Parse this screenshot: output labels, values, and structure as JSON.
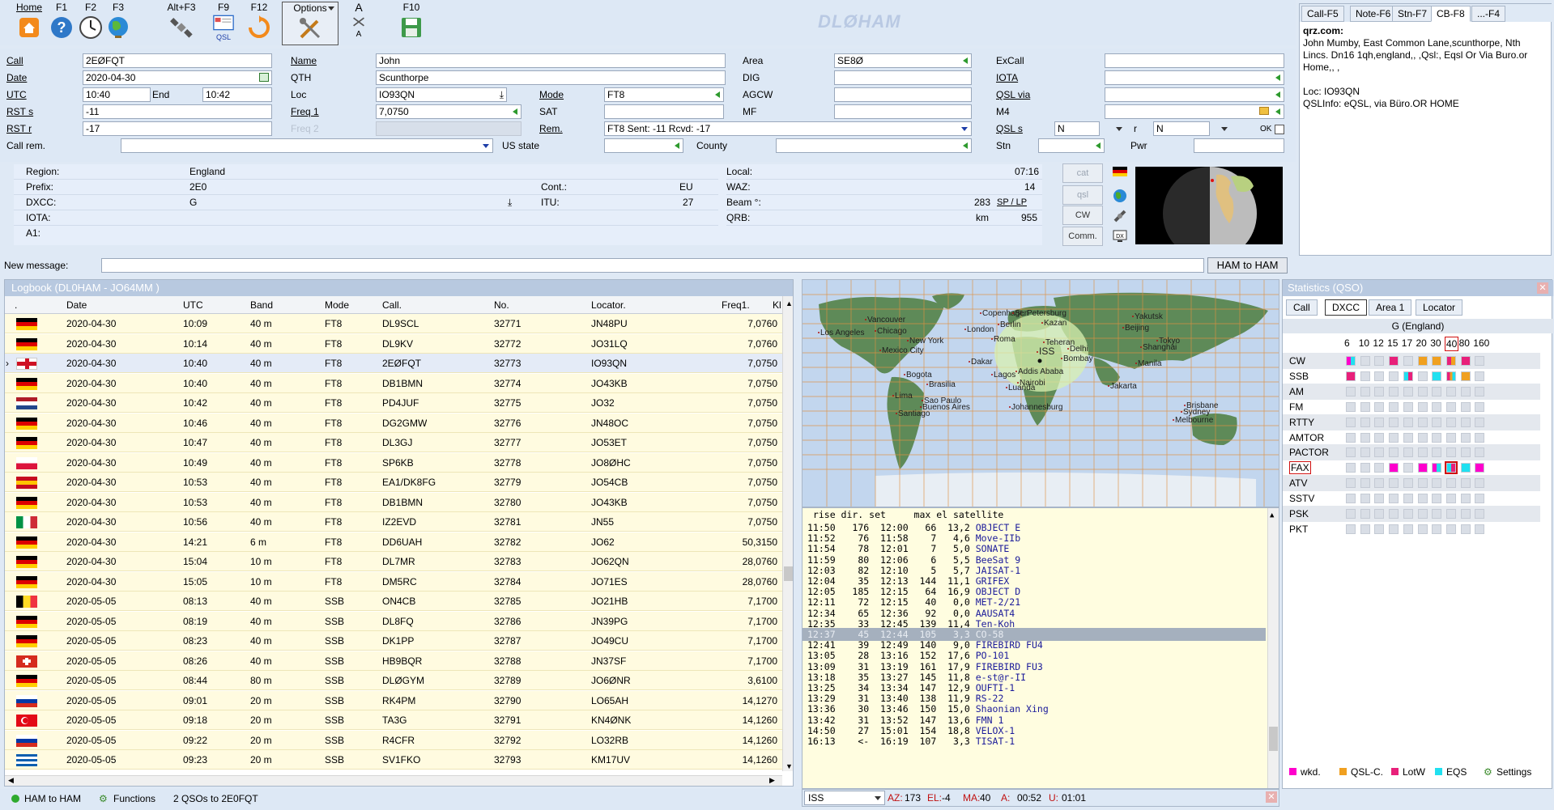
{
  "toolbar": {
    "buttons": [
      {
        "label": "Home",
        "icon": "home-icon"
      },
      {
        "label": "F1",
        "icon": "help-icon"
      },
      {
        "label": "F2",
        "icon": "clock-icon"
      },
      {
        "label": "F3",
        "icon": "globe-icon"
      },
      {
        "label": "Alt+F3",
        "icon": "satellite-icon"
      },
      {
        "label": "F9",
        "icon": "qsl-card-icon",
        "sub": "QSL"
      },
      {
        "label": "F12",
        "icon": "refresh-icon"
      },
      {
        "label": "Options",
        "icon": "tools-icon"
      },
      {
        "label": "A",
        "icon": "font-size-icon",
        "sub": "A"
      },
      {
        "label": "F10",
        "icon": "save-icon"
      }
    ],
    "brand": "DLØHAM"
  },
  "entry": {
    "call_label": "Call",
    "call": "2EØFQT",
    "date_label": "Date",
    "date": "2020-04-30",
    "utc_label": "UTC",
    "utc": "10:40",
    "end_label": "End",
    "end": "10:42",
    "rsts_label": "RST s",
    "rsts": "-11",
    "rstr_label": "RST r",
    "rstr": "-17",
    "callrem_label": "Call rem.",
    "callrem": "",
    "name_label": "Name",
    "name": "John",
    "qth_label": "QTH",
    "qth": "Scunthorpe",
    "loc_label": "Loc",
    "loc": "IO93QN",
    "freq1_label": "Freq 1",
    "freq1": "7,0750",
    "freq2_label": "Freq 2",
    "freq2": "",
    "mode_label": "Mode",
    "mode": "FT8",
    "sat_label": "SAT",
    "sat": "",
    "rem_label": "Rem.",
    "rem": "FT8  Sent: -11  Rcvd: -17",
    "usstate_label": "US state",
    "usstate": "",
    "area_label": "Area",
    "area": "SE8Ø",
    "dig_label": "DIG",
    "dig": "",
    "agcw_label": "AGCW",
    "agcw": "",
    "mf_label": "MF",
    "mf": "",
    "county_label": "County",
    "county": "",
    "excall_label": "ExCall",
    "excall": "",
    "iota_label": "IOTA",
    "iota": "",
    "qslvia_label": "QSL via",
    "qslvia": "",
    "m4_label": "M4",
    "m4": "",
    "qsls_label": "QSL s",
    "qsls": "N",
    "qslr_label": "r",
    "qslr": "N",
    "ok_label": "OK",
    "stn_label": "Stn",
    "stn": "",
    "pwr_label": "Pwr",
    "pwr": ""
  },
  "info": {
    "region_label": "Region:",
    "region": "England",
    "prefix_label": "Prefix:",
    "prefix": "2E0",
    "dxcc_label": "DXCC:",
    "dxcc": "G",
    "iota_label": "IOTA:",
    "iota": "",
    "a1_label": "A1:",
    "a1": "",
    "cont_label": "Cont.:",
    "cont": "EU",
    "itu_label": "ITU:",
    "itu": "27",
    "local_label": "Local:",
    "local": "07:16",
    "waz_label": "WAZ:",
    "waz": "14",
    "beam_label": "Beam °:",
    "beam": "283",
    "splp": "SP / LP",
    "qrb_label": "QRB:",
    "qrb_unit": "km",
    "qrb": "955"
  },
  "side_buttons": [
    "cat",
    "qsl",
    "CW",
    "Comm."
  ],
  "qrz_tabs": [
    "Call-F5",
    "Note-F6",
    "Stn-F7",
    "CB-F8",
    "...-F4"
  ],
  "qrz": {
    "source": "qrz.com:",
    "address": "John Mumby, East Common Lane,scunthorpe, Nth Lincs. Dn16 1qh,england,, ,Qsl:, Eqsl Or Via Buro.or Home,, ,",
    "loc": "Loc:  IO93QN",
    "qslinfo": "QSLInfo:  eQSL, via Büro.OR HOME"
  },
  "message": {
    "label": "New message:",
    "value": "",
    "button": "HAM to HAM"
  },
  "logbook": {
    "title": "Logbook  (DL0HAM - JO64MM )",
    "headers": [
      ".",
      "Date",
      "UTC",
      "Band",
      "Mode",
      "Call.",
      "No.",
      "Locator.",
      "Freq1.",
      "Kl"
    ],
    "rows": [
      {
        "flag": "de",
        "date": "2020-04-30",
        "utc": "10:09",
        "band": "40 m",
        "mode": "FT8",
        "call": "DL9SCL",
        "no": "32771",
        "loc": "JN48PU",
        "freq": "7,0760"
      },
      {
        "flag": "de",
        "date": "2020-04-30",
        "utc": "10:14",
        "band": "40 m",
        "mode": "FT8",
        "call": "DL9KV",
        "no": "32772",
        "loc": "JO31LQ",
        "freq": "7,0760"
      },
      {
        "flag": "en",
        "date": "2020-04-30",
        "utc": "10:40",
        "band": "40 m",
        "mode": "FT8",
        "call": "2EØFQT",
        "no": "32773",
        "loc": "IO93QN",
        "freq": "7,0750"
      },
      {
        "flag": "de",
        "date": "2020-04-30",
        "utc": "10:40",
        "band": "40 m",
        "mode": "FT8",
        "call": "DB1BMN",
        "no": "32774",
        "loc": "JO43KB",
        "freq": "7,0750"
      },
      {
        "flag": "nl",
        "date": "2020-04-30",
        "utc": "10:42",
        "band": "40 m",
        "mode": "FT8",
        "call": "PD4JUF",
        "no": "32775",
        "loc": "JO32",
        "freq": "7,0750"
      },
      {
        "flag": "de",
        "date": "2020-04-30",
        "utc": "10:46",
        "band": "40 m",
        "mode": "FT8",
        "call": "DG2GMW",
        "no": "32776",
        "loc": "JN48OC",
        "freq": "7,0750"
      },
      {
        "flag": "de",
        "date": "2020-04-30",
        "utc": "10:47",
        "band": "40 m",
        "mode": "FT8",
        "call": "DL3GJ",
        "no": "32777",
        "loc": "JO53ET",
        "freq": "7,0750"
      },
      {
        "flag": "pl",
        "date": "2020-04-30",
        "utc": "10:49",
        "band": "40 m",
        "mode": "FT8",
        "call": "SP6KB",
        "no": "32778",
        "loc": "JO8ØHC",
        "freq": "7,0750"
      },
      {
        "flag": "es",
        "date": "2020-04-30",
        "utc": "10:53",
        "band": "40 m",
        "mode": "FT8",
        "call": "EA1/DK8FG",
        "no": "32779",
        "loc": "JO54CB",
        "freq": "7,0750"
      },
      {
        "flag": "de",
        "date": "2020-04-30",
        "utc": "10:53",
        "band": "40 m",
        "mode": "FT8",
        "call": "DB1BMN",
        "no": "32780",
        "loc": "JO43KB",
        "freq": "7,0750"
      },
      {
        "flag": "it",
        "date": "2020-04-30",
        "utc": "10:56",
        "band": "40 m",
        "mode": "FT8",
        "call": "IZ2EVD",
        "no": "32781",
        "loc": "JN55",
        "freq": "7,0750"
      },
      {
        "flag": "de",
        "date": "2020-04-30",
        "utc": "14:21",
        "band": "6 m",
        "mode": "FT8",
        "call": "DD6UAH",
        "no": "32782",
        "loc": "JO62",
        "freq": "50,3150"
      },
      {
        "flag": "de",
        "date": "2020-04-30",
        "utc": "15:04",
        "band": "10 m",
        "mode": "FT8",
        "call": "DL7MR",
        "no": "32783",
        "loc": "JO62QN",
        "freq": "28,0760"
      },
      {
        "flag": "de",
        "date": "2020-04-30",
        "utc": "15:05",
        "band": "10 m",
        "mode": "FT8",
        "call": "DM5RC",
        "no": "32784",
        "loc": "JO71ES",
        "freq": "28,0760"
      },
      {
        "flag": "be",
        "date": "2020-05-05",
        "utc": "08:13",
        "band": "40 m",
        "mode": "SSB",
        "call": "ON4CB",
        "no": "32785",
        "loc": "JO21HB",
        "freq": "7,1700"
      },
      {
        "flag": "de",
        "date": "2020-05-05",
        "utc": "08:19",
        "band": "40 m",
        "mode": "SSB",
        "call": "DL8FQ",
        "no": "32786",
        "loc": "JN39PG",
        "freq": "7,1700"
      },
      {
        "flag": "de",
        "date": "2020-05-05",
        "utc": "08:23",
        "band": "40 m",
        "mode": "SSB",
        "call": "DK1PP",
        "no": "32787",
        "loc": "JO49CU",
        "freq": "7,1700"
      },
      {
        "flag": "ch",
        "date": "2020-05-05",
        "utc": "08:26",
        "band": "40 m",
        "mode": "SSB",
        "call": "HB9BQR",
        "no": "32788",
        "loc": "JN37SF",
        "freq": "7,1700"
      },
      {
        "flag": "de",
        "date": "2020-05-05",
        "utc": "08:44",
        "band": "80 m",
        "mode": "SSB",
        "call": "DLØGYM",
        "no": "32789",
        "loc": "JO6ØNR",
        "freq": "3,6100"
      },
      {
        "flag": "ru",
        "date": "2020-05-05",
        "utc": "09:01",
        "band": "20 m",
        "mode": "SSB",
        "call": "RK4PM",
        "no": "32790",
        "loc": "LO65AH",
        "freq": "14,1270"
      },
      {
        "flag": "tr",
        "date": "2020-05-05",
        "utc": "09:18",
        "band": "20 m",
        "mode": "SSB",
        "call": "TA3G",
        "no": "32791",
        "loc": "KN4ØNK",
        "freq": "14,1260"
      },
      {
        "flag": "ru",
        "date": "2020-05-05",
        "utc": "09:22",
        "band": "20 m",
        "mode": "SSB",
        "call": "R4CFR",
        "no": "32792",
        "loc": "LO32RB",
        "freq": "14,1260"
      },
      {
        "flag": "gr",
        "date": "2020-05-05",
        "utc": "09:23",
        "band": "20 m",
        "mode": "SSB",
        "call": "SV1FKO",
        "no": "32793",
        "loc": "KM17UV",
        "freq": "14,1260"
      }
    ]
  },
  "map": {
    "labels": [
      "Vancouver",
      "Los Angeles",
      "Chicago",
      "New York",
      "Mexico City",
      "Bogota",
      "Lima",
      "Brasilia",
      "Sao Paulo",
      "Buenos Aires",
      "Santiago",
      "Copenhagen",
      "London",
      "Berlin",
      "Roma",
      "Dakar",
      "Lagos",
      "Addis Ababa",
      "Luanda",
      "Nairobi",
      "Johannesburg",
      "St. Petersburg",
      "Kazan",
      "Teheran",
      "Delhi",
      "Bombay",
      "Beijing",
      "Shanghai",
      "Tokyo",
      "Manila",
      "Jakarta",
      "Yakutsk",
      "Brisbane",
      "Sydney",
      "Melbourne",
      "ISS"
    ]
  },
  "sat": {
    "header": " rise dir. set     max el satellite",
    "rows": [
      {
        "rise": "11:50",
        "dir": "176",
        "set": "12:00",
        "max": "66",
        "el": "13,2",
        "name": "OBJECT E"
      },
      {
        "rise": "11:52",
        "dir": "76",
        "set": "11:58",
        "max": "7",
        "el": "4,6",
        "name": "Move-IIb"
      },
      {
        "rise": "11:54",
        "dir": "78",
        "set": "12:01",
        "max": "7",
        "el": "5,0",
        "name": "SONATE"
      },
      {
        "rise": "11:59",
        "dir": "80",
        "set": "12:06",
        "max": "6",
        "el": "5,5",
        "name": "BeeSat 9"
      },
      {
        "rise": "12:03",
        "dir": "82",
        "set": "12:10",
        "max": "5",
        "el": "5,7",
        "name": "JAISAT-1"
      },
      {
        "rise": "12:04",
        "dir": "35",
        "set": "12:13",
        "max": "144",
        "el": "11,1",
        "name": "GRIFEX"
      },
      {
        "rise": "12:05",
        "dir": "185",
        "set": "12:15",
        "max": "64",
        "el": "16,9",
        "name": "OBJECT D"
      },
      {
        "rise": "12:11",
        "dir": "72",
        "set": "12:15",
        "max": "40",
        "el": "0,0",
        "name": "MET-2/21"
      },
      {
        "rise": "12:34",
        "dir": "65",
        "set": "12:36",
        "max": "92",
        "el": "0,0",
        "name": "AAUSAT4"
      },
      {
        "rise": "12:35",
        "dir": "33",
        "set": "12:45",
        "max": "139",
        "el": "11,4",
        "name": "Ten-Koh"
      },
      {
        "rise": "12:37",
        "dir": "45",
        "set": "12:44",
        "max": "105",
        "el": "3,3",
        "name": "CO-58"
      },
      {
        "rise": "12:41",
        "dir": "39",
        "set": "12:49",
        "max": "140",
        "el": "9,0",
        "name": "FIREBIRD FU4"
      },
      {
        "rise": "13:05",
        "dir": "28",
        "set": "13:16",
        "max": "152",
        "el": "17,6",
        "name": "PO-101"
      },
      {
        "rise": "13:09",
        "dir": "31",
        "set": "13:19",
        "max": "161",
        "el": "17,9",
        "name": "FIREBIRD FU3"
      },
      {
        "rise": "13:18",
        "dir": "35",
        "set": "13:27",
        "max": "145",
        "el": "11,8",
        "name": "e-st@r-II"
      },
      {
        "rise": "13:25",
        "dir": "34",
        "set": "13:34",
        "max": "147",
        "el": "12,9",
        "name": "OUFTI-1"
      },
      {
        "rise": "13:29",
        "dir": "31",
        "set": "13:40",
        "max": "138",
        "el": "11,9",
        "name": "RS-22"
      },
      {
        "rise": "13:36",
        "dir": "30",
        "set": "13:46",
        "max": "150",
        "el": "15,0",
        "name": "Shaonian Xing"
      },
      {
        "rise": "13:42",
        "dir": "31",
        "set": "13:52",
        "max": "147",
        "el": "13,6",
        "name": "FMN 1"
      },
      {
        "rise": "14:50",
        "dir": "27",
        "set": "15:01",
        "max": "154",
        "el": "18,8",
        "name": "VELOX-1"
      },
      {
        "rise": "16:13",
        "dir": "<-",
        "set": "16:19",
        "max": "107",
        "el": "3,3",
        "name": "TISAT-1"
      }
    ],
    "selected_sat": "ISS",
    "az_label": "AZ:",
    "az": "173",
    "el_label": "EL:",
    "el": "-4",
    "ma_label": "MA:",
    "ma": "40",
    "a_label": "A:",
    "a": "00:52",
    "u_label": "U:",
    "u": "01:01"
  },
  "stats": {
    "title": "Statistics (QSO)",
    "tabs": [
      "Call",
      "DXCC",
      "Area 1",
      "Locator"
    ],
    "entity": "G (England)",
    "bands": [
      "6",
      "10",
      "12",
      "15",
      "17",
      "20",
      "30",
      "40",
      "80",
      "160"
    ],
    "modes": [
      "CW",
      "SSB",
      "AM",
      "FM",
      "RTTY",
      "AMTOR",
      "PACTOR",
      "FAX",
      "ATV",
      "SSTV",
      "PSK",
      "PKT"
    ],
    "legend": [
      "wkd.",
      "QSL-C.",
      "LotW",
      "EQS",
      "Settings"
    ],
    "colors": {
      "wkd": "#ff00cc",
      "qslc": "#f0a020",
      "lotw": "#e8207a",
      "eqs": "#20e0f0"
    }
  },
  "status": {
    "ham_to_ham": "HAM to HAM",
    "functions": "Functions",
    "qso_count": "2 QSOs to 2E0FQT"
  }
}
